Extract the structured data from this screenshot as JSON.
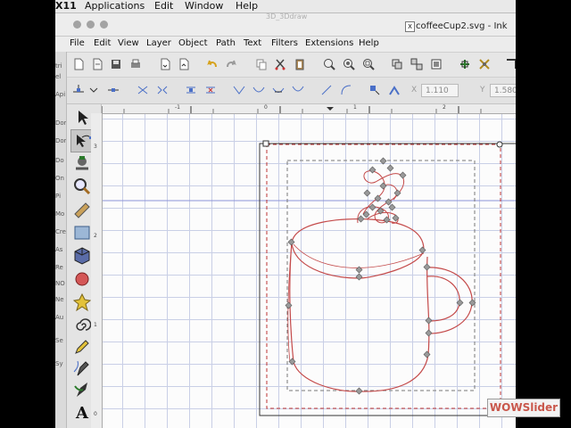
{
  "os_menubar": {
    "items": [
      "X11",
      "Applications",
      "Edit",
      "Window",
      "Help"
    ]
  },
  "window": {
    "background_title": "3D_3Ddraw",
    "title": "coffeeCup2.svg - Ink"
  },
  "menu": {
    "items": [
      "File",
      "Edit",
      "View",
      "Layer",
      "Object",
      "Path",
      "Text",
      "Filters",
      "Extensions",
      "Help"
    ]
  },
  "toolbar": {
    "x_label": "X",
    "x_value": "1.110",
    "y_label": "Y",
    "y_value": "1.580"
  },
  "left_panel": {
    "fragments": [
      "tri",
      "el",
      "Api",
      "Dor",
      "Dor",
      "Do",
      "On",
      "Pi",
      "Mo",
      "Cre",
      "As",
      "Re",
      "NO",
      "Ne",
      "Au",
      "Se",
      "Sy"
    ]
  },
  "ruler": {
    "top_ticks": [
      "-1",
      "0",
      "1",
      "2",
      "3"
    ],
    "left_ticks": [
      "3",
      "2",
      "1",
      "0"
    ]
  },
  "watermark": "WOWSlider",
  "icons": {
    "tools": [
      "selector-icon",
      "node-editor-icon",
      "tweak-icon",
      "zoom-icon",
      "measure-icon",
      "rectangle-icon",
      "box3d-icon",
      "ellipse-icon",
      "star-icon",
      "spiral-icon",
      "pencil-icon",
      "pen-icon",
      "calligraphy-icon",
      "text-icon"
    ]
  },
  "colors": {
    "path_stroke": "#c44a4a",
    "node_fill": "#9a9a9a",
    "grid": "#c9cfe6",
    "guide": "#8d93d8"
  }
}
